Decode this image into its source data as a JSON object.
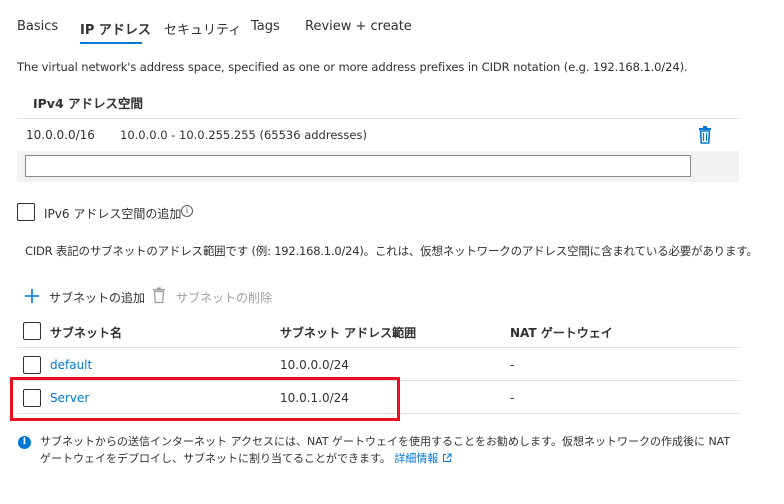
{
  "tabs": [
    {
      "label": "Basics"
    },
    {
      "label": "IP アドレス"
    },
    {
      "label": "セキュリティ"
    },
    {
      "label": "Tags"
    },
    {
      "label": "Review + create"
    }
  ],
  "description": "The virtual network's address space, specified as one or more address prefixes in CIDR notation (e.g. 192.168.1.0/24).",
  "ipv4": {
    "title": "IPv4 アドレス空間",
    "entry": {
      "prefix": "10.0.0.0/16",
      "range": "10.0.0.0 - 10.0.255.255 (65536 addresses)"
    },
    "input_value": ""
  },
  "ipv6": {
    "label": "IPv6 アドレス空間の追加",
    "checked": false
  },
  "cidr_description": "CIDR 表記のサブネットのアドレス範囲です (例: 192.168.1.0/24)。これは、仮想ネットワークのアドレス空間に含まれている必要があります。",
  "toolbar": {
    "add_label": "サブネットの追加",
    "delete_label": "サブネットの削除"
  },
  "subnets": {
    "headers": {
      "name": "サブネット名",
      "range": "サブネット アドレス範囲",
      "nat": "NAT ゲートウェイ"
    },
    "rows": [
      {
        "name": "default",
        "range": "10.0.0.0/24",
        "nat": "-"
      },
      {
        "name": "Server",
        "range": "10.0.1.0/24",
        "nat": "-"
      }
    ]
  },
  "footer": {
    "text": "サブネットからの送信インターネット アクセスには、NAT ゲートウェイを使用することをお勧めします。仮想ネットワークの作成後に NAT ゲートウェイをデプロイし、サブネットに割り当てることができます。",
    "link": "詳細情報"
  },
  "colors": {
    "accent": "#0078d4",
    "highlight": "#e81123"
  }
}
